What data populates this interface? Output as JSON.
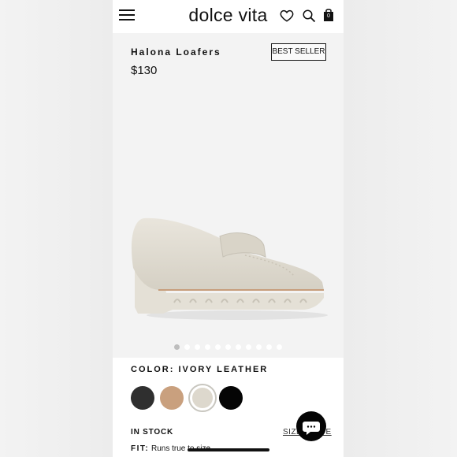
{
  "header": {
    "brand": "dolce vita",
    "bag_count": "0",
    "icons": [
      "menu-icon",
      "heart-icon",
      "search-icon",
      "shopping-bag-icon"
    ]
  },
  "product": {
    "name": "Halona Loafers",
    "badge": "BEST SELLER",
    "price": "$130"
  },
  "gallery": {
    "image_count": 11,
    "active_index": 0
  },
  "color": {
    "label": "COLOR: IVORY LEATHER",
    "swatches": [
      {
        "name": "black",
        "hex": "#2f2f2f"
      },
      {
        "name": "tan",
        "hex": "#c9a07e"
      },
      {
        "name": "ivory",
        "hex": "#ddd8cd",
        "selected": true
      },
      {
        "name": "onyx",
        "hex": "#050505"
      }
    ]
  },
  "stock": {
    "status": "IN STOCK",
    "size_guide_link": "SIZE GUIDE"
  },
  "fit": {
    "label": "FIT:",
    "value": "Runs true to size"
  },
  "chat": {
    "icon": "chat-bubble-icon"
  }
}
